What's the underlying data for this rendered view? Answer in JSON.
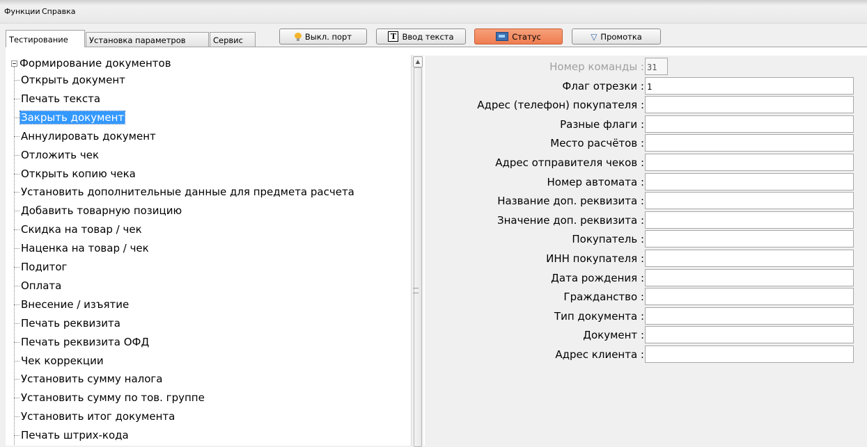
{
  "menu": [
    "Функции",
    "Справка"
  ],
  "tabs": [
    "Тестирование",
    "Установка параметров",
    "Сервис"
  ],
  "toolbar": {
    "port_off": "Выкл. порт",
    "text_input": "Ввод текста",
    "status": "Статус",
    "feed": "Промотка",
    "status_color": "#ef7c50"
  },
  "tree": {
    "root": "Формирование документов",
    "items": [
      "Открыть документ",
      "Печать текста",
      "Закрыть документ",
      "Аннулировать документ",
      "Отложить чек",
      "Открыть копию чека",
      "Установить дополнительные данные для предмета расчета",
      "Добавить товарную позицию",
      "Скидка на товар / чек",
      "Наценка на товар / чек",
      "Подитог",
      "Оплата",
      "Внесение / изъятие",
      "Печать реквизита",
      "Печать реквизита ОФД",
      "Чек коррекции",
      "Установить сумму налога",
      "Установить сумму по тов. группе",
      "Установить итог документа",
      "Печать штрих-кода"
    ],
    "selected": "Закрыть документ",
    "selection_color": "#3399ff"
  },
  "form": {
    "fields": [
      {
        "label": "Номер команды :",
        "value": "31"
      },
      {
        "label": "Флаг отрезки :",
        "value": "1"
      },
      {
        "label": "Адрес (телефон) покупателя :",
        "value": ""
      },
      {
        "label": "Разные флаги :",
        "value": ""
      },
      {
        "label": "Место расчётов :",
        "value": ""
      },
      {
        "label": "Адрес отправителя чеков :",
        "value": ""
      },
      {
        "label": "Номер автомата :",
        "value": ""
      },
      {
        "label": "Название доп. реквизита :",
        "value": ""
      },
      {
        "label": "Значение доп. реквизита :",
        "value": ""
      },
      {
        "label": "Покупатель :",
        "value": ""
      },
      {
        "label": "ИНН покупателя :",
        "value": ""
      },
      {
        "label": "Дата рождения :",
        "value": ""
      },
      {
        "label": "Гражданство :",
        "value": ""
      },
      {
        "label": "Тип документа :",
        "value": ""
      },
      {
        "label": "Документ :",
        "value": ""
      },
      {
        "label": "Адрес клиента :",
        "value": ""
      }
    ]
  }
}
